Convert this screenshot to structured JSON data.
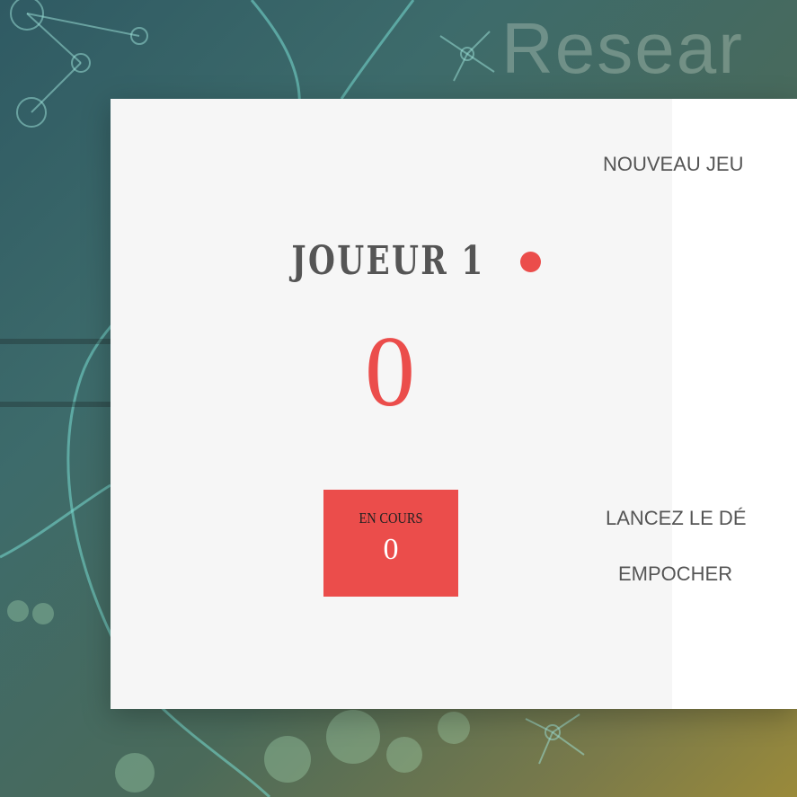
{
  "background": {
    "word": "Resear"
  },
  "game": {
    "player": {
      "name": "JOUEUR 1",
      "score": "0",
      "active": true
    },
    "current": {
      "label": "EN COURS",
      "score": "0"
    },
    "buttons": {
      "new_game": "NOUVEAU JEU",
      "roll": "LANCEZ LE DÉ",
      "hold": "EMPOCHER"
    }
  },
  "colors": {
    "accent": "#eb4d4b",
    "text": "#555555",
    "panel": "#f6f6f6"
  }
}
